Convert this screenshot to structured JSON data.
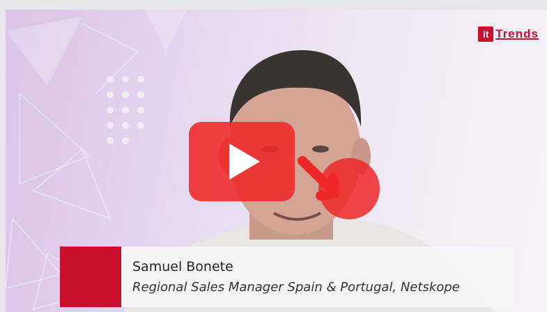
{
  "video": {
    "logo": {
      "badge": "it",
      "text": "Trends",
      "accent_color": "#c8102e"
    },
    "play_button": {
      "icon": "play-icon",
      "color": "#ee2828"
    },
    "lower_third": {
      "name": "Samuel Bonete",
      "title": "Regional Sales Manager Spain & Portugal, Netskope",
      "accent_color": "#c8102e"
    }
  }
}
